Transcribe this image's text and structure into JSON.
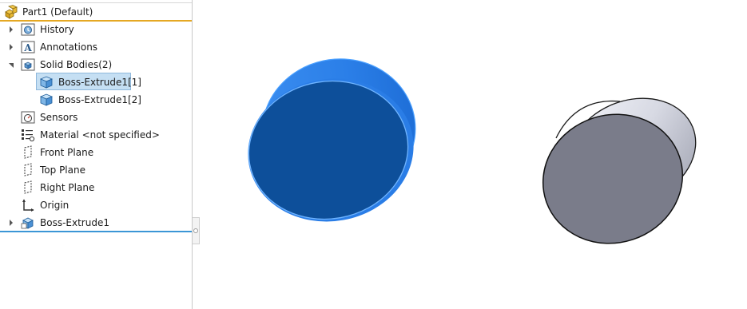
{
  "feature_tree": {
    "root": {
      "label": "Part1  (Default)",
      "icon": "part-icon"
    },
    "items": [
      {
        "label": "History",
        "icon": "history-folder-icon",
        "expandable": true,
        "expanded": false
      },
      {
        "label": "Annotations",
        "icon": "annotations-folder-icon",
        "expandable": true,
        "expanded": false
      },
      {
        "label": "Solid Bodies(2)",
        "icon": "solid-bodies-folder-icon",
        "expandable": true,
        "expanded": true
      },
      {
        "label": "Boss-Extrude1[1]",
        "icon": "solid-body-icon",
        "selected": true,
        "child": true
      },
      {
        "label": "Boss-Extrude1[2]",
        "icon": "solid-body-icon",
        "child": true
      },
      {
        "label": "Sensors",
        "icon": "sensors-folder-icon",
        "expandable": false
      },
      {
        "label": "Material <not specified>",
        "icon": "material-icon",
        "expandable": false
      },
      {
        "label": "Front Plane",
        "icon": "plane-icon",
        "expandable": false
      },
      {
        "label": "Top Plane",
        "icon": "plane-icon",
        "expandable": false
      },
      {
        "label": "Right Plane",
        "icon": "plane-icon",
        "expandable": false
      },
      {
        "label": "Origin",
        "icon": "origin-icon",
        "expandable": false
      },
      {
        "label": "Boss-Extrude1",
        "icon": "extrude-feature-icon",
        "expandable": true,
        "expanded": false
      }
    ]
  },
  "colors": {
    "root_underline": "#e5a823",
    "rollback_bar": "#3b96d6",
    "selected_body": "#1f7de0",
    "unselected_body": "#7a7c8a"
  },
  "viewport": {
    "bodies": [
      {
        "name": "Boss-Extrude1[1]",
        "state": "selected"
      },
      {
        "name": "Boss-Extrude1[2]",
        "state": "unselected"
      }
    ]
  }
}
